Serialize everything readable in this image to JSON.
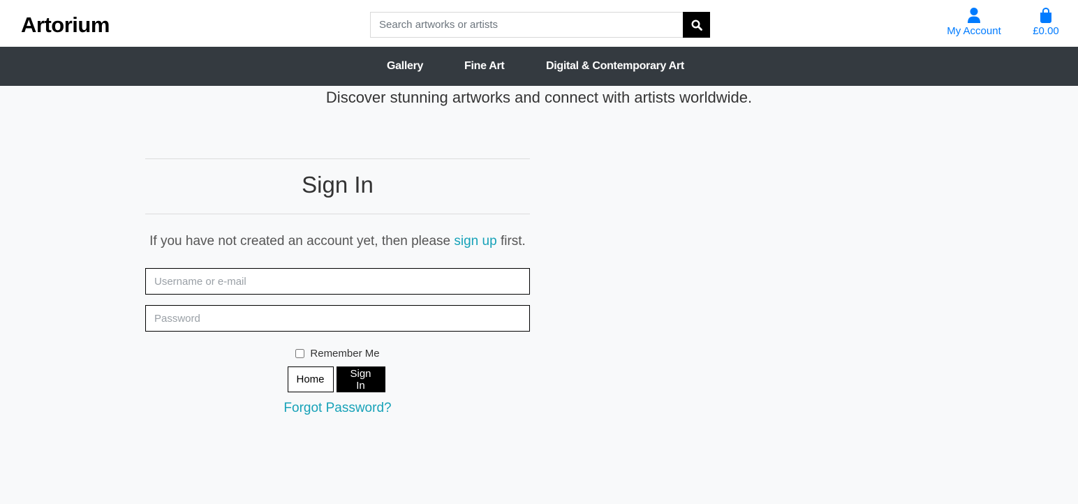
{
  "header": {
    "logo": "Artorium",
    "search_placeholder": "Search artworks or artists",
    "search_icon": "search-icon",
    "account_label": "My Account",
    "account_icon": "user-icon",
    "bag_total": "£0.00",
    "bag_icon": "shopping-bag-icon"
  },
  "nav": {
    "items": [
      {
        "label": "Gallery"
      },
      {
        "label": "Fine Art"
      },
      {
        "label": "Digital & Contemporary Art"
      }
    ]
  },
  "tagline": "Discover stunning artworks and connect with artists worldwide.",
  "signin": {
    "title": "Sign In",
    "info_before": "If you have not created an account yet, then please",
    "info_link": "sign up",
    "info_after": "first.",
    "username_placeholder": "Username or e-mail",
    "password_placeholder": "Password",
    "remember_label": "Remember Me",
    "home_button": "Home",
    "signin_button": "Sign In",
    "forgot_link": "Forgot Password?"
  },
  "colors": {
    "nav_bg": "#343a40",
    "accent_blue": "#007bff",
    "link_teal": "#17a2b8",
    "page_bg": "#f8f9fa"
  }
}
